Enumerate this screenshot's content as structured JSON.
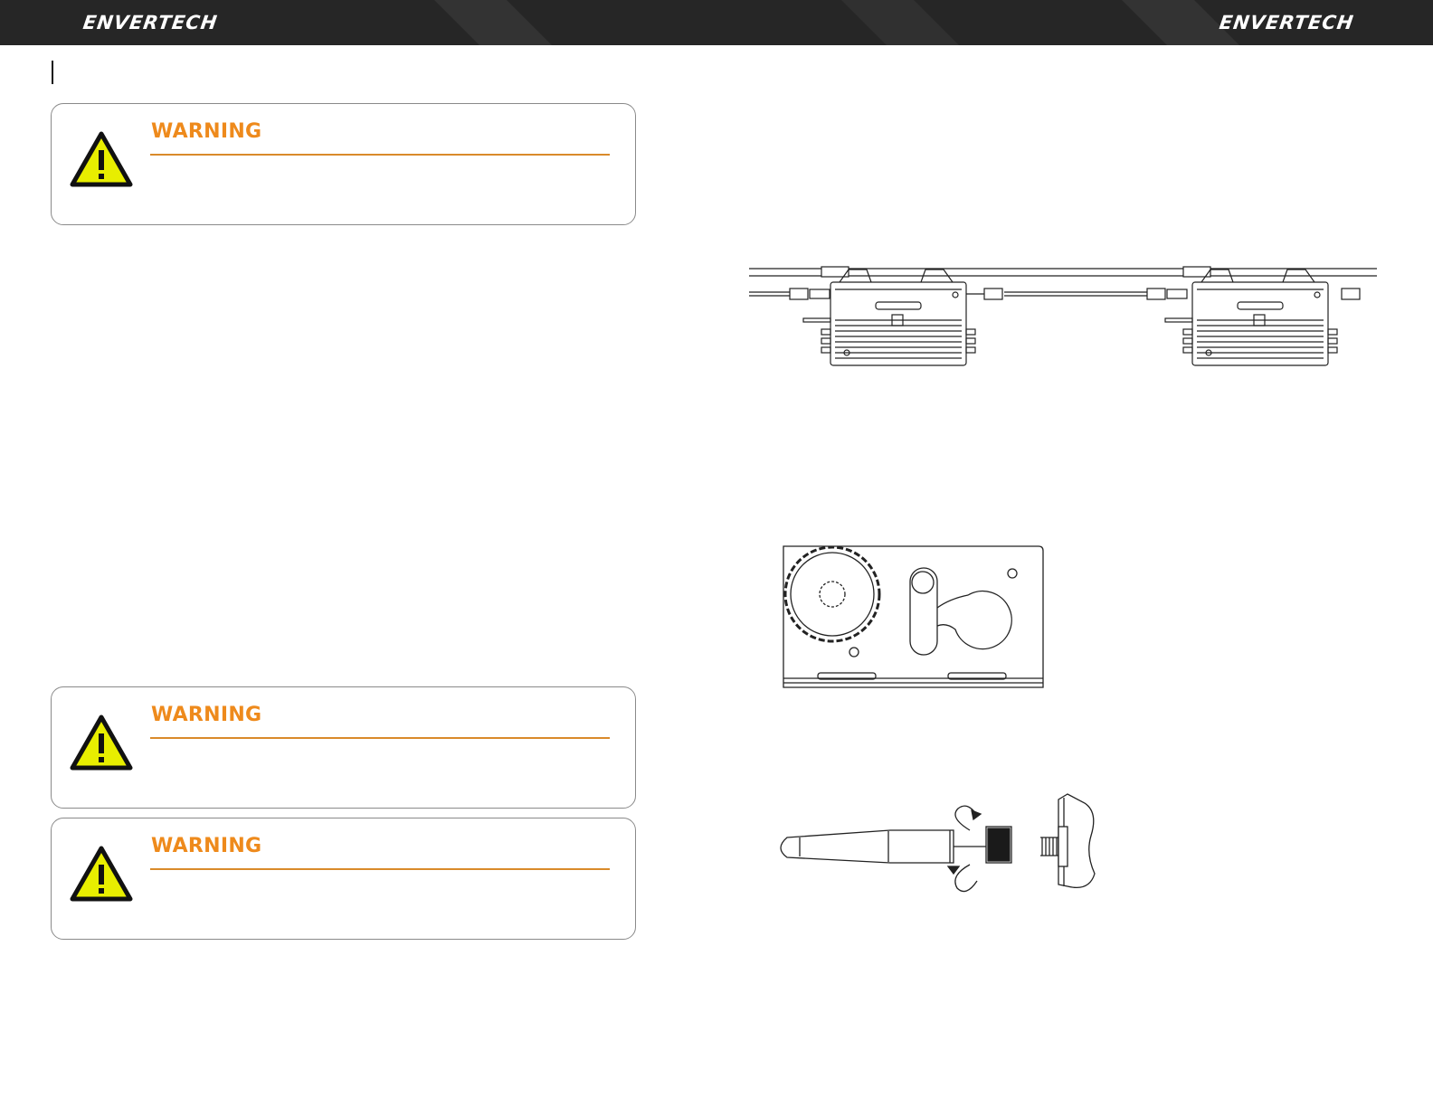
{
  "header": {
    "brand_left": "ENVERTECH",
    "brand_right": "ENVERTECH",
    "background_color": "#262626"
  },
  "warnings": [
    {
      "title": "WARNING",
      "icon": "warning-triangle-icon"
    },
    {
      "title": "WARNING",
      "icon": "warning-triangle-icon"
    },
    {
      "title": "WARNING",
      "icon": "warning-triangle-icon"
    }
  ],
  "figures": {
    "inverters": {
      "icon": "microinverter-chain-figure"
    },
    "bracket": {
      "icon": "mounting-bracket-figure"
    },
    "antenna": {
      "icon": "antenna-installation-figure"
    }
  },
  "colors": {
    "accent_orange": "#ee8a1c",
    "warning_yellow": "#e8ee00",
    "rule_orange": "#d98a2a"
  }
}
